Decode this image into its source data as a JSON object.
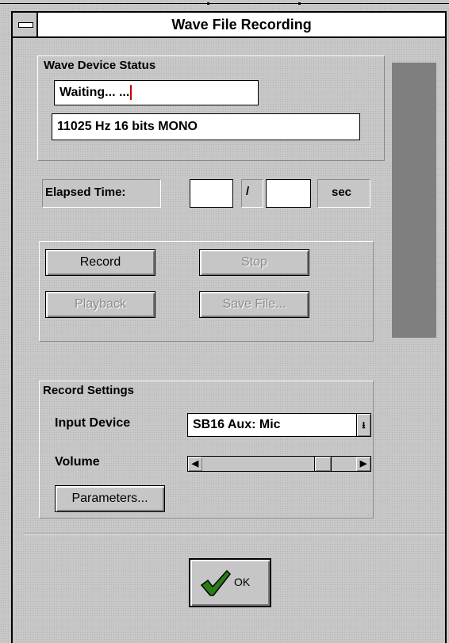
{
  "window": {
    "title": "Wave File Recording"
  },
  "device_status": {
    "label": "Wave Device Status",
    "state": "Waiting... ...",
    "format": "11025 Hz 16 bits MONO"
  },
  "elapsed": {
    "label": "Elapsed Time:",
    "elapsed_value": "",
    "total_value": "",
    "separator": "/",
    "unit": "sec"
  },
  "buttons": {
    "record": "Record",
    "stop": "Stop",
    "playback": "Playback",
    "save_file": "Save File..."
  },
  "level_meter": {
    "level": 1.0
  },
  "record_settings": {
    "label": "Record Settings",
    "input_device_label": "Input Device",
    "input_device_value": "SB16 Aux: Mic",
    "volume_label": "Volume",
    "volume_level": 0.82,
    "parameters_button": "Parameters..."
  },
  "ok_button": {
    "label": "OK"
  },
  "colors": {
    "meter": "#7f7f7f",
    "ok_check": "#2a7d16"
  },
  "icons": {
    "sysmenu": "system-menu-icon",
    "ok": "checkmark-icon"
  }
}
